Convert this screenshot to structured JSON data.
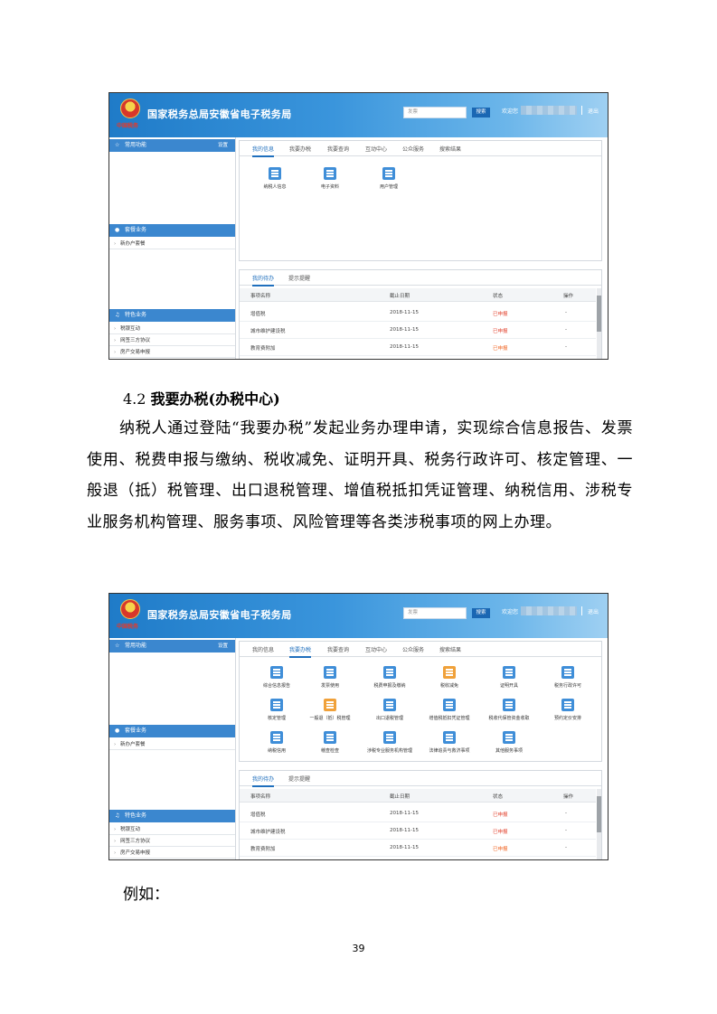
{
  "portal": {
    "title": "国家税务总局安徽省电子税务局",
    "emblem_caption": "中国税务",
    "search_placeholder": "发票",
    "search_button": "搜索",
    "user_label": "欢迎您",
    "logout": "退出",
    "sidebar": {
      "common_title": "常用功能",
      "common_setting": "设置",
      "query_title": "套餐业务",
      "query_items": [
        "新办户套餐"
      ],
      "special_title": "特色业务",
      "special_items": [
        "税银互动",
        "网签三方协议",
        "房产交易申报"
      ]
    },
    "tabs": [
      "我的信息",
      "我要办税",
      "我要查询",
      "互动中心",
      "公众服务",
      "搜索结果"
    ],
    "my_info_services": [
      "纳税人信息",
      "电子资料",
      "用户管理"
    ],
    "tax_services": [
      "综合信息报告",
      "发票使用",
      "税费申报及缴纳",
      "税收减免",
      "证明开具",
      "税务行政许可",
      "核定管理",
      "一般退（抵）税管理",
      "出口退税管理",
      "增值税抵扣凭证管理",
      "税收代保管资金收取",
      "预约定价安排",
      "纳税信用",
      "稽查检查",
      "涉税专业服务机构管理",
      "法律追责与救济事项",
      "其他服务事项"
    ],
    "todo_tabs": [
      "我的待办",
      "提示提醒"
    ],
    "todo_columns": [
      "事项名称",
      "截止日期",
      "状态",
      "操作"
    ],
    "todo_rows": [
      {
        "name": "增值税",
        "deadline": "2018-11-15",
        "status": "已申报",
        "op": "-"
      },
      {
        "name": "城市维护建设税",
        "deadline": "2018-11-15",
        "status": "已申报",
        "op": "-"
      },
      {
        "name": "教育费附加",
        "deadline": "2018-11-15",
        "status": "已申报",
        "op": "-"
      }
    ]
  },
  "document": {
    "section_number": "4.2",
    "section_title": "我要办税(办税中心)",
    "paragraph": "纳税人通过登陆“我要办税”发起业务办理申请，实现综合信息报告、发票使用、税费申报与缴纳、税收减免、证明开具、税务行政许可、核定管理、一般退（抵）税管理、出口退税管理、增值税抵扣凭证管理、纳税信用、涉税专业服务机构管理、服务事项、风险管理等各类涉税事项的网上办理。",
    "example_label": "例如：",
    "page_number": "39"
  },
  "colors": {
    "banner_blue": "#1f7bc8",
    "sidebar_head": "#3b87cf",
    "active_tab": "#1f6fbd",
    "status_red": "#e2412c"
  }
}
